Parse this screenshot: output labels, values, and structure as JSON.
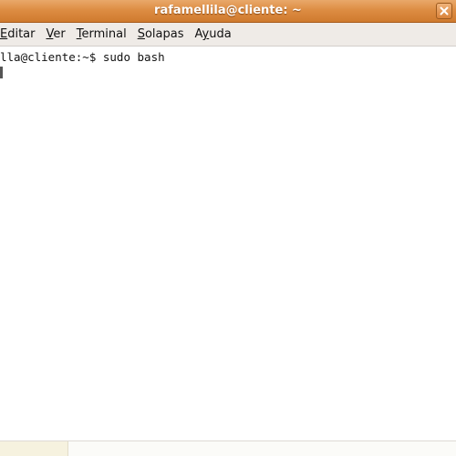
{
  "window": {
    "title": "rafamellila@cliente: ~"
  },
  "menubar": {
    "items": [
      {
        "label": "Editar",
        "mnemonic_index": 0
      },
      {
        "label": "Ver",
        "mnemonic_index": 0
      },
      {
        "label": "Terminal",
        "mnemonic_index": 0
      },
      {
        "label": "Solapas",
        "mnemonic_index": 0
      },
      {
        "label": "Ayuda",
        "mnemonic_index": 1
      }
    ]
  },
  "terminal": {
    "prompt": "lla@cliente:~$ sudo bash"
  },
  "colors": {
    "titlebar": "#dd8d43",
    "menubar": "#efebe7",
    "terminal_bg": "#ffffff",
    "text": "#111111"
  },
  "icons": {
    "close": "close-icon"
  }
}
